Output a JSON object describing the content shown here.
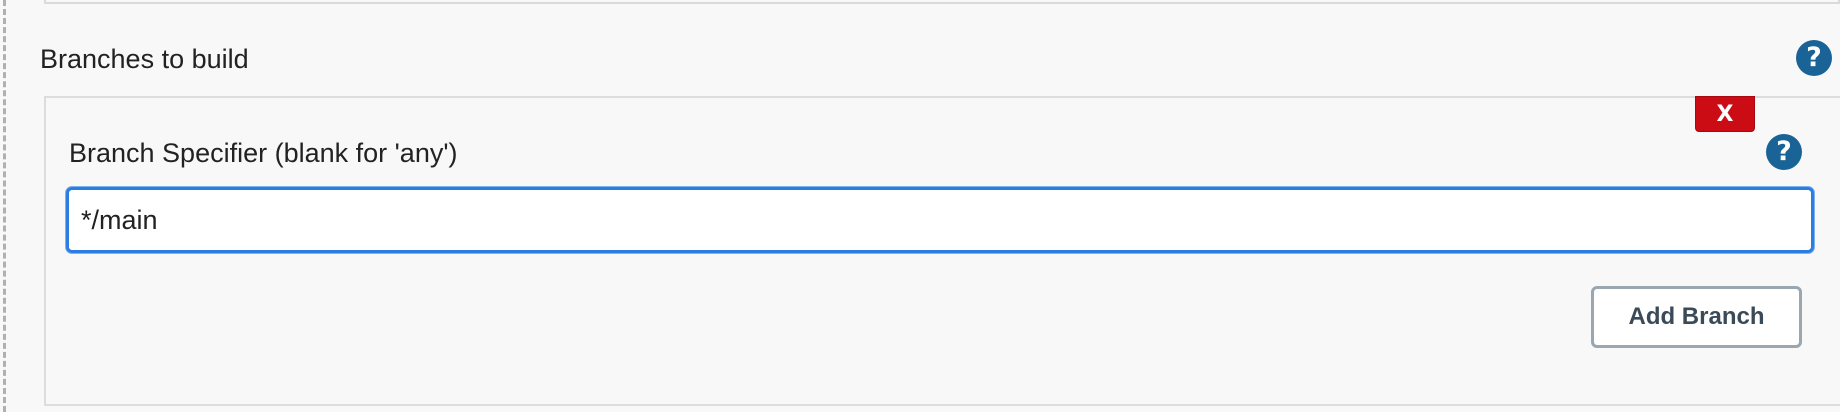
{
  "section": {
    "title": "Branches to build",
    "help_icon": "?"
  },
  "branch_entry": {
    "delete_label": "X",
    "label": "Branch Specifier (blank for 'any')",
    "help_icon": "?",
    "value": "*/main"
  },
  "actions": {
    "add_branch_label": "Add Branch"
  },
  "colors": {
    "help_icon": "#1a6396",
    "delete_button": "#cc0c14",
    "input_focus_border": "#2b7de0"
  }
}
